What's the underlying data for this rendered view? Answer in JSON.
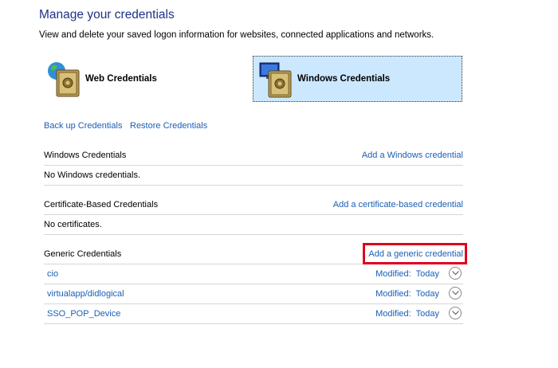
{
  "page": {
    "title": "Manage your credentials",
    "subtitle": "View and delete your saved logon information for websites, connected applications and networks."
  },
  "tiles": {
    "web": {
      "label": "Web Credentials",
      "icon": "web-credentials-vault-icon"
    },
    "windows": {
      "label": "Windows Credentials",
      "icon": "windows-credentials-vault-icon",
      "selected": true
    }
  },
  "actions": {
    "backup": "Back up Credentials",
    "restore": "Restore Credentials"
  },
  "sections": {
    "windows": {
      "title": "Windows Credentials",
      "add": "Add a Windows credential",
      "empty": "No Windows credentials."
    },
    "certificate": {
      "title": "Certificate-Based Credentials",
      "add": "Add a certificate-based credential",
      "empty": "No certificates."
    },
    "generic": {
      "title": "Generic Credentials",
      "add": "Add a generic credential",
      "items": [
        {
          "name": "cio",
          "modified_label": "Modified:",
          "modified_value": "Today"
        },
        {
          "name": "virtualapp/didlogical",
          "modified_label": "Modified:",
          "modified_value": "Today"
        },
        {
          "name": "SSO_POP_Device",
          "modified_label": "Modified:",
          "modified_value": "Today"
        }
      ]
    }
  },
  "colors": {
    "link": "#1a5fb4",
    "title": "#1e3287",
    "selected_tile": "#cce8ff",
    "highlight": "#e0001b"
  }
}
